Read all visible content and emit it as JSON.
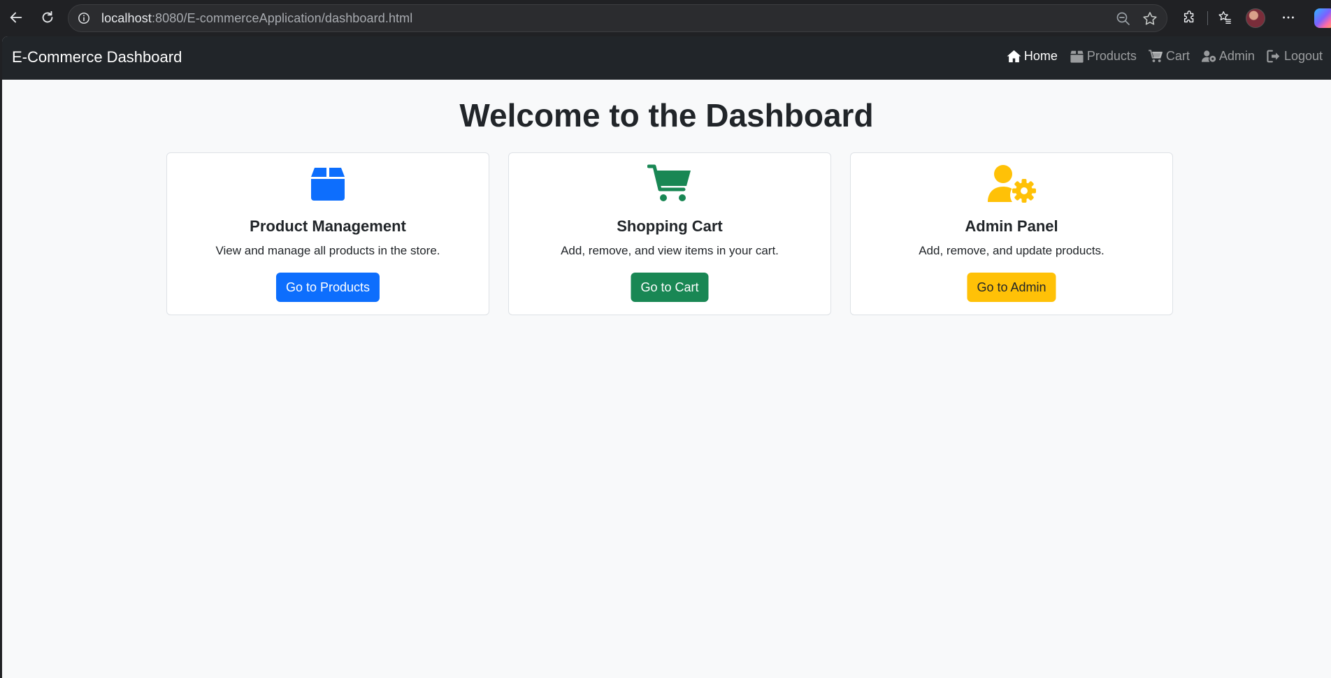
{
  "browser": {
    "url_host": "localhost",
    "url_rest": ":8080/E-commerceApplication/dashboard.html"
  },
  "navbar": {
    "brand": "E-Commerce Dashboard",
    "links": [
      {
        "label": "Home",
        "icon": "home-icon"
      },
      {
        "label": "Products",
        "icon": "box-icon"
      },
      {
        "label": "Cart",
        "icon": "cart-icon"
      },
      {
        "label": "Admin",
        "icon": "user-gear-icon"
      },
      {
        "label": "Logout",
        "icon": "logout-icon"
      }
    ]
  },
  "main": {
    "heading": "Welcome to the Dashboard",
    "cards": [
      {
        "title": "Product Management",
        "text": "View and manage all products in the store.",
        "button": "Go to Products",
        "icon": "box-icon",
        "color": "#0d6efd"
      },
      {
        "title": "Shopping Cart",
        "text": "Add, remove, and view items in your cart.",
        "button": "Go to Cart",
        "icon": "cart-icon",
        "color": "#198754"
      },
      {
        "title": "Admin Panel",
        "text": "Add, remove, and update products.",
        "button": "Go to Admin",
        "icon": "user-gear-icon",
        "color": "#ffc107"
      }
    ]
  }
}
